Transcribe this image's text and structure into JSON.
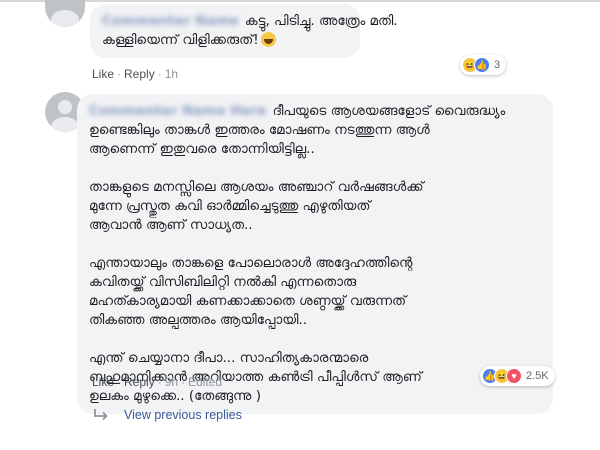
{
  "comment1": {
    "text_lines": [
      "കട്ടു, പിടിച്ചു. അത്രേം മതി.",
      "കള്ളിയെന്ന് വിളിക്കരുത്!"
    ],
    "actions": {
      "like": "Like",
      "reply": "Reply",
      "time": "1h"
    },
    "reactions": {
      "icons": [
        "haha-icon",
        "like-icon"
      ],
      "count": "3"
    }
  },
  "comment2": {
    "paragraphs": [
      [
        "ദീപയുടെ ആശയങ്ങളോട് വൈരുദ്ധ്യം",
        "ഉണ്ടെങ്കിലും താങ്കൾ ഇത്തരം മോഷണം നടത്തുന്ന ആൾ",
        "ആണെന്ന് ഇതുവരെ തോന്നിയിട്ടില്ല.."
      ],
      [
        "താങ്കളുടെ മനസ്സിലെ ആശയം അഞ്ചാറ് വർഷങ്ങൾക്ക്",
        "മുന്നേ പ്രസ്തുത കവി ഓർമ്മിച്ചെടുത്തു എഴുതിയത്",
        "ആവാൻ ആണ് സാധ്യത.."
      ],
      [
        "എന്തായാലും താങ്കളെ പോലൊരാൾ അദ്ദേഹത്തിന്റെ",
        "കവിതയ്ക്ക് വിസിബിലിറ്റി നൽകി എന്നതൊരു",
        "മഹത്കാര്യമായി കണക്കാക്കാതെ ശണ്ഠയ്ക്ക് വരുന്നത്",
        "തികഞ്ഞ അല്പത്തരം ആയിപ്പോയി.."
      ],
      [
        "എന്ത് ചെയ്യാനാ ദീപാ... സാഹിത്യകാരന്മാരെ",
        "ബഹുമാനിക്കാൻ അറിയാത്ത കൺട്രി പീപ്പിൾസ് ആണ്",
        "ഉലകം മുഴുക്കെ.. (തേങ്ങുന്നു )"
      ]
    ],
    "actions": {
      "like": "Like",
      "reply": "Reply",
      "time": "9h",
      "edited": "Edited"
    },
    "reactions": {
      "icons": [
        "like-icon",
        "haha-icon",
        "love-icon"
      ],
      "count": "2.5K"
    }
  },
  "view_previous": "View previous replies",
  "colors": {
    "link": "#385898",
    "bubble": "#f2f3f5",
    "meta": "#90949c"
  }
}
